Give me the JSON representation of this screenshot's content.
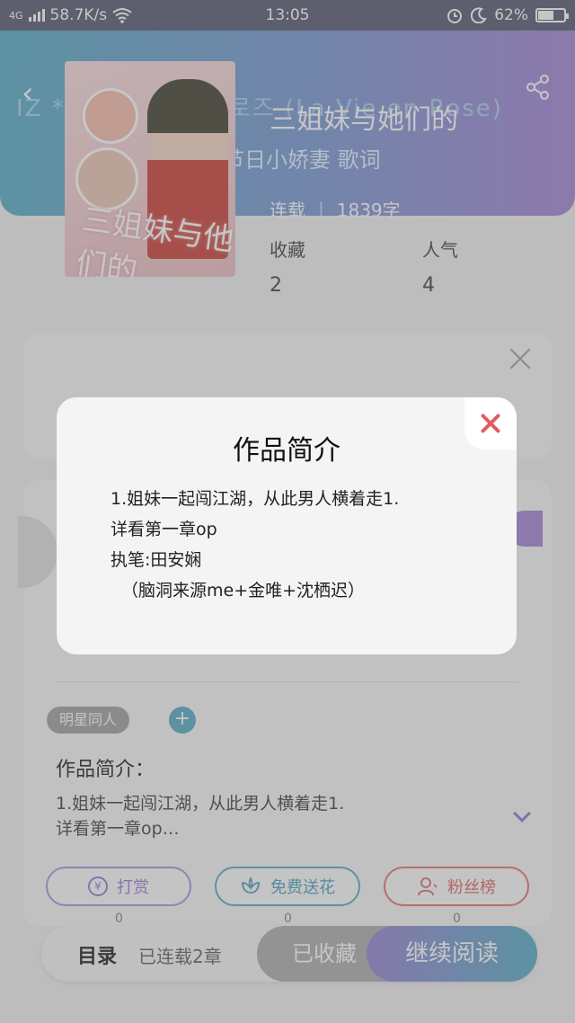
{
  "status_bar": {
    "network": "4G",
    "speed": "58.7K/s",
    "time": "13:05",
    "battery": "62%",
    "battery_level": 0.62
  },
  "header": {
    "marquee": "IZ * ONE - 라비앙로즈 (La Vie en Rose)",
    "title": "三姐妹与她们的",
    "subtitle": "那些节日小娇妻",
    "subtitle_tail": "歌词",
    "status": "连载",
    "word_count": "1839字"
  },
  "stats": {
    "favorites_label": "收藏",
    "favorites_value": "2",
    "popularity_label": "人气",
    "popularity_value": "4"
  },
  "cover": {
    "title": "三姐妹与他们的"
  },
  "tags": {
    "tag": "明星同人",
    "add": "+"
  },
  "intro": {
    "heading": "作品简介：",
    "text_line1": "1.姐妹一起闯江湖，从此男人横着走1.",
    "text_line2": "详看第一章op…"
  },
  "actions": {
    "tip": "打赏",
    "tip_icon": "¥",
    "tip_count": "0",
    "flower": "免费送花",
    "flower_count": "0",
    "fans": "粉丝榜",
    "fans_count": "0"
  },
  "bottom": {
    "toc": "目录",
    "serial": "已连载2章",
    "favorited": "已收藏",
    "continue": "继续阅读"
  },
  "modal": {
    "title": "作品简介",
    "lines": [
      "1.姐妹一起闯江湖，从此男人横着走1.",
      "详看第一章op",
      "执笔:田安娴",
      "（脑洞来源me+金唯+沈栖迟）"
    ]
  },
  "colors": {
    "accent_blue": "#4aa6c2",
    "accent_purple": "#9d7bd2",
    "close_red": "#e45a60",
    "fans_red": "#e4686c"
  }
}
